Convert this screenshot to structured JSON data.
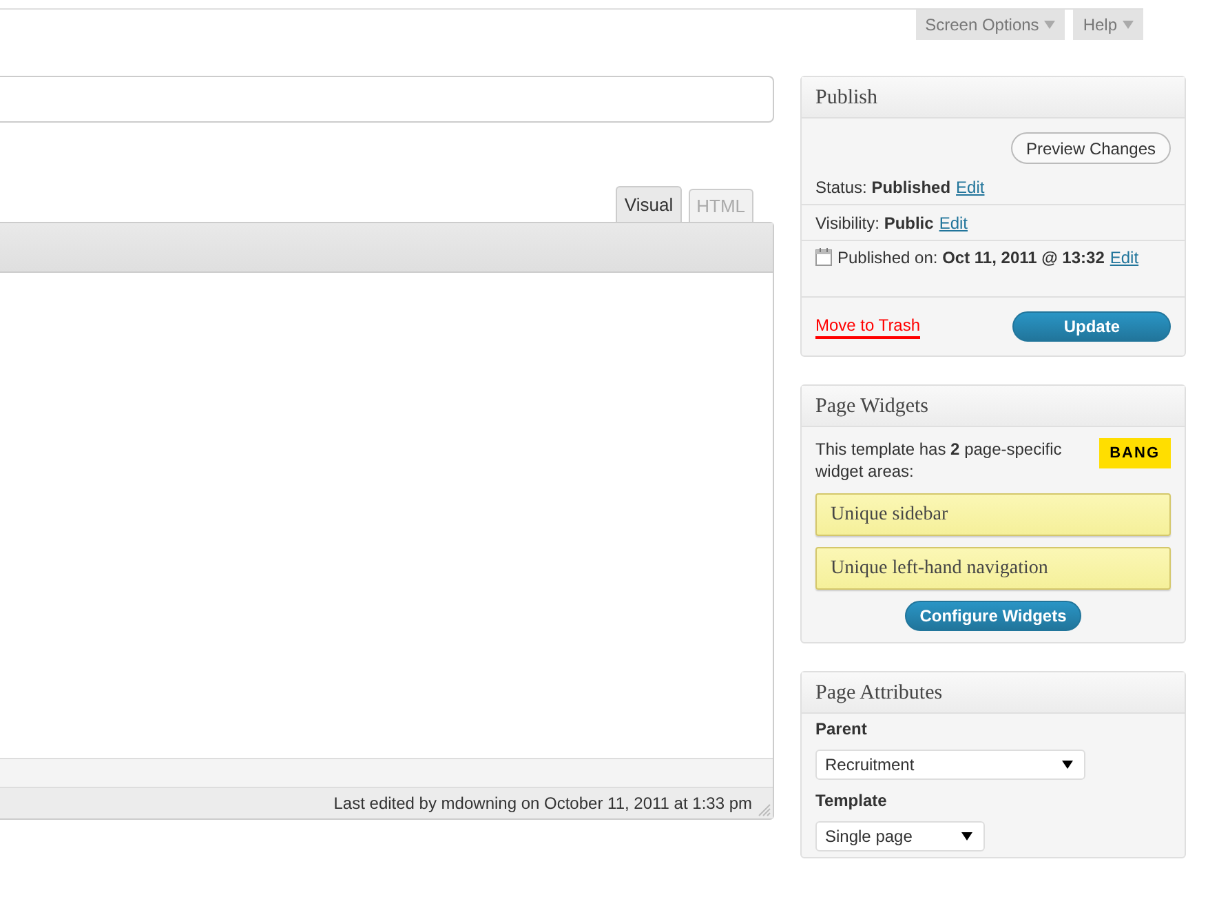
{
  "screen_meta": [
    {
      "label": "Screen Options"
    },
    {
      "label": "Help"
    }
  ],
  "editor": {
    "tabs": [
      {
        "label": "Visual",
        "selected": true
      },
      {
        "label": "HTML",
        "selected": false
      }
    ],
    "last_edited": "Last edited by mdowning on October 11, 2011 at 1:33 pm"
  },
  "publish": {
    "title": "Publish",
    "preview_button": "Preview Changes",
    "rows": [
      {
        "kind": "status",
        "label": "Status:",
        "value": "Published",
        "link": "Edit"
      },
      {
        "kind": "visibility",
        "label": "Visibility:",
        "value": "Public",
        "link": "Edit"
      },
      {
        "kind": "date",
        "label": "Published on:",
        "value": "Oct 11, 2011 @ 13:32",
        "link": "Edit"
      }
    ],
    "trash_link": "Move to Trash",
    "update_button": "Update"
  },
  "page_widgets": {
    "title": "Page Widgets",
    "description": "This template has **2** page-specific widget areas:",
    "badge": "BANG",
    "areas": [
      {
        "label": "Unique sidebar"
      },
      {
        "label": "Unique left-hand navigation"
      }
    ],
    "button": "Configure Widgets"
  },
  "page_attributes": {
    "title": "Page Attributes",
    "fields": [
      {
        "label": "Parent",
        "value": "Recruitment"
      },
      {
        "label": "Template",
        "value": "Single page"
      }
    ]
  }
}
